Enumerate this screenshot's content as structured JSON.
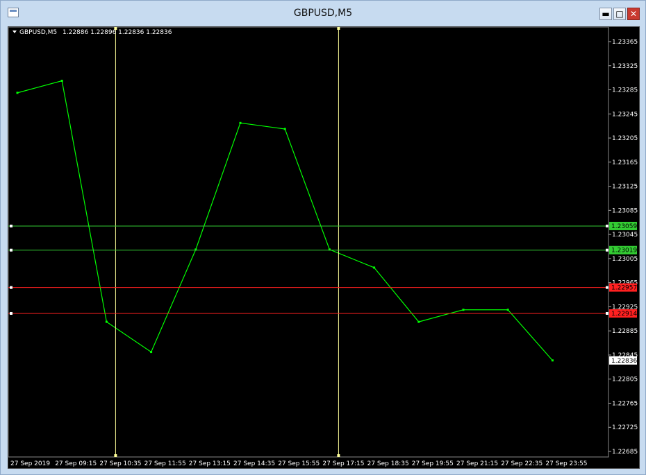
{
  "window": {
    "title": "GBPUSD,M5",
    "buttons": {
      "minimize": "minimize-icon",
      "maximize": "maximize-icon",
      "close": "close-icon"
    }
  },
  "colors": {
    "background": "#000000",
    "candle": "#00ff00",
    "grid_vline": "#ffff99",
    "hline_green": "#33cc33",
    "hline_red": "#ff2020"
  },
  "chart_data": {
    "type": "line",
    "symbol_label": "GBPUSD,M5",
    "ohlc_label": "1.22886 1.22896 1.22836 1.22836",
    "xticks": [
      "27 Sep 2019",
      "27 Sep 09:15",
      "27 Sep 10:35",
      "27 Sep 11:55",
      "27 Sep 13:15",
      "27 Sep 14:35",
      "27 Sep 15:55",
      "27 Sep 17:15",
      "27 Sep 18:35",
      "27 Sep 19:55",
      "27 Sep 21:15",
      "27 Sep 22:35",
      "27 Sep 23:55"
    ],
    "yticks": [
      "1.23365",
      "1.23325",
      "1.23285",
      "1.23245",
      "1.23205",
      "1.23165",
      "1.23125",
      "1.23085",
      "1.23045",
      "1.23005",
      "1.22965",
      "1.22925",
      "1.22885",
      "1.22845",
      "1.22805",
      "1.22765",
      "1.22725",
      "1.22685"
    ],
    "ylim": [
      1.22685,
      1.23365
    ],
    "vertical_lines_at": [
      "27 Sep 10:35",
      "27 Sep 17:15"
    ],
    "horizontal_lines": [
      {
        "label": "1.23059",
        "value": 1.23059,
        "color": "green"
      },
      {
        "label": "1.23019",
        "value": 1.23019,
        "color": "green"
      },
      {
        "label": "1.22957",
        "value": 1.22957,
        "color": "red"
      },
      {
        "label": "1.22914",
        "value": 1.22914,
        "color": "red"
      }
    ],
    "current_price": "1.22836",
    "series": [
      {
        "x": [
          "27 Sep 2019",
          "27 Sep 09:15",
          "27 Sep 10:35",
          "27 Sep 11:55",
          "27 Sep 13:15",
          "27 Sep 14:35",
          "27 Sep 15:55",
          "27 Sep 17:15",
          "27 Sep 18:35",
          "27 Sep 19:55",
          "27 Sep 21:15",
          "27 Sep 22:35",
          "27 Sep 23:55"
        ],
        "values": [
          1.2328,
          1.233,
          1.229,
          1.2285,
          1.2302,
          1.2323,
          1.2322,
          1.2302,
          1.2299,
          1.229,
          1.2292,
          1.2292,
          1.22836
        ]
      }
    ]
  }
}
